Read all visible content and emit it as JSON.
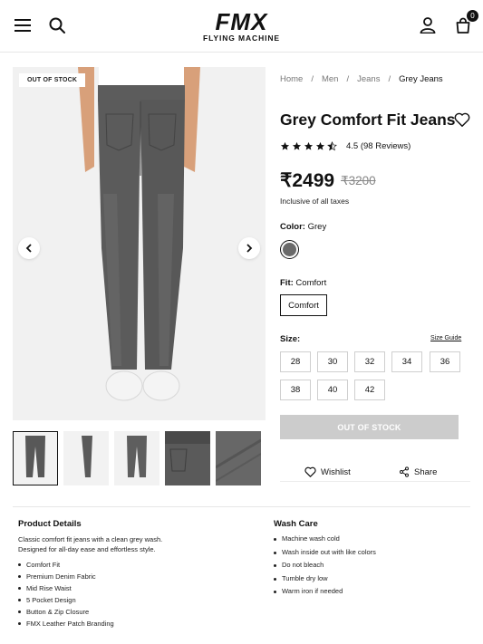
{
  "header": {
    "brand": "FMX",
    "brand_sub": "FLYING MACHINE",
    "cart_count": "0",
    "icons": [
      "menu-icon",
      "search-icon",
      "account-icon",
      "cart-icon"
    ]
  },
  "gallery": {
    "badge": "OUT OF STOCK",
    "thumbnail_count": 5,
    "active_thumbnail": 1
  },
  "product": {
    "breadcrumb": [
      "Home",
      "Men",
      "Jeans",
      "Grey Jeans"
    ],
    "title": "Grey Comfort Fit Jeans",
    "rating_value": 4.5,
    "rating_text": "4.5 (98 Reviews)",
    "price": "₹2499",
    "mrp": "₹3200",
    "tax_note": "Inclusive of all taxes",
    "color_label": "Color:",
    "color_value": "Grey",
    "swatch_color": "#6a6a6a",
    "fit_label": "Fit:",
    "fit_value": "Comfort",
    "fit_option": "Comfort",
    "size_label": "Size:",
    "size_guide": "Size Guide",
    "sizes": [
      "28",
      "30",
      "32",
      "34",
      "36",
      "38",
      "40",
      "42"
    ],
    "cta": "OUT OF STOCK",
    "wishlist": "Wishlist",
    "share": "Share"
  },
  "details": {
    "title": "Product Details",
    "description_1": "Classic comfort fit jeans with a clean grey wash.",
    "description_2": "Designed for all-day ease and effortless style.",
    "features": [
      "Comfort Fit",
      "Premium Denim Fabric",
      "Mid Rise Waist",
      "5 Pocket Design",
      "Button & Zip Closure",
      "FMX Leather Patch Branding"
    ]
  },
  "wash_care": {
    "title": "Wash Care",
    "items": [
      "Machine wash cold",
      "Wash inside out with like colors",
      "Do not bleach",
      "Tumble dry low",
      "Warm iron if needed"
    ]
  },
  "colors": {
    "accent": "#111111",
    "disabled_button": "#cccccc",
    "jeans": "#585858"
  }
}
